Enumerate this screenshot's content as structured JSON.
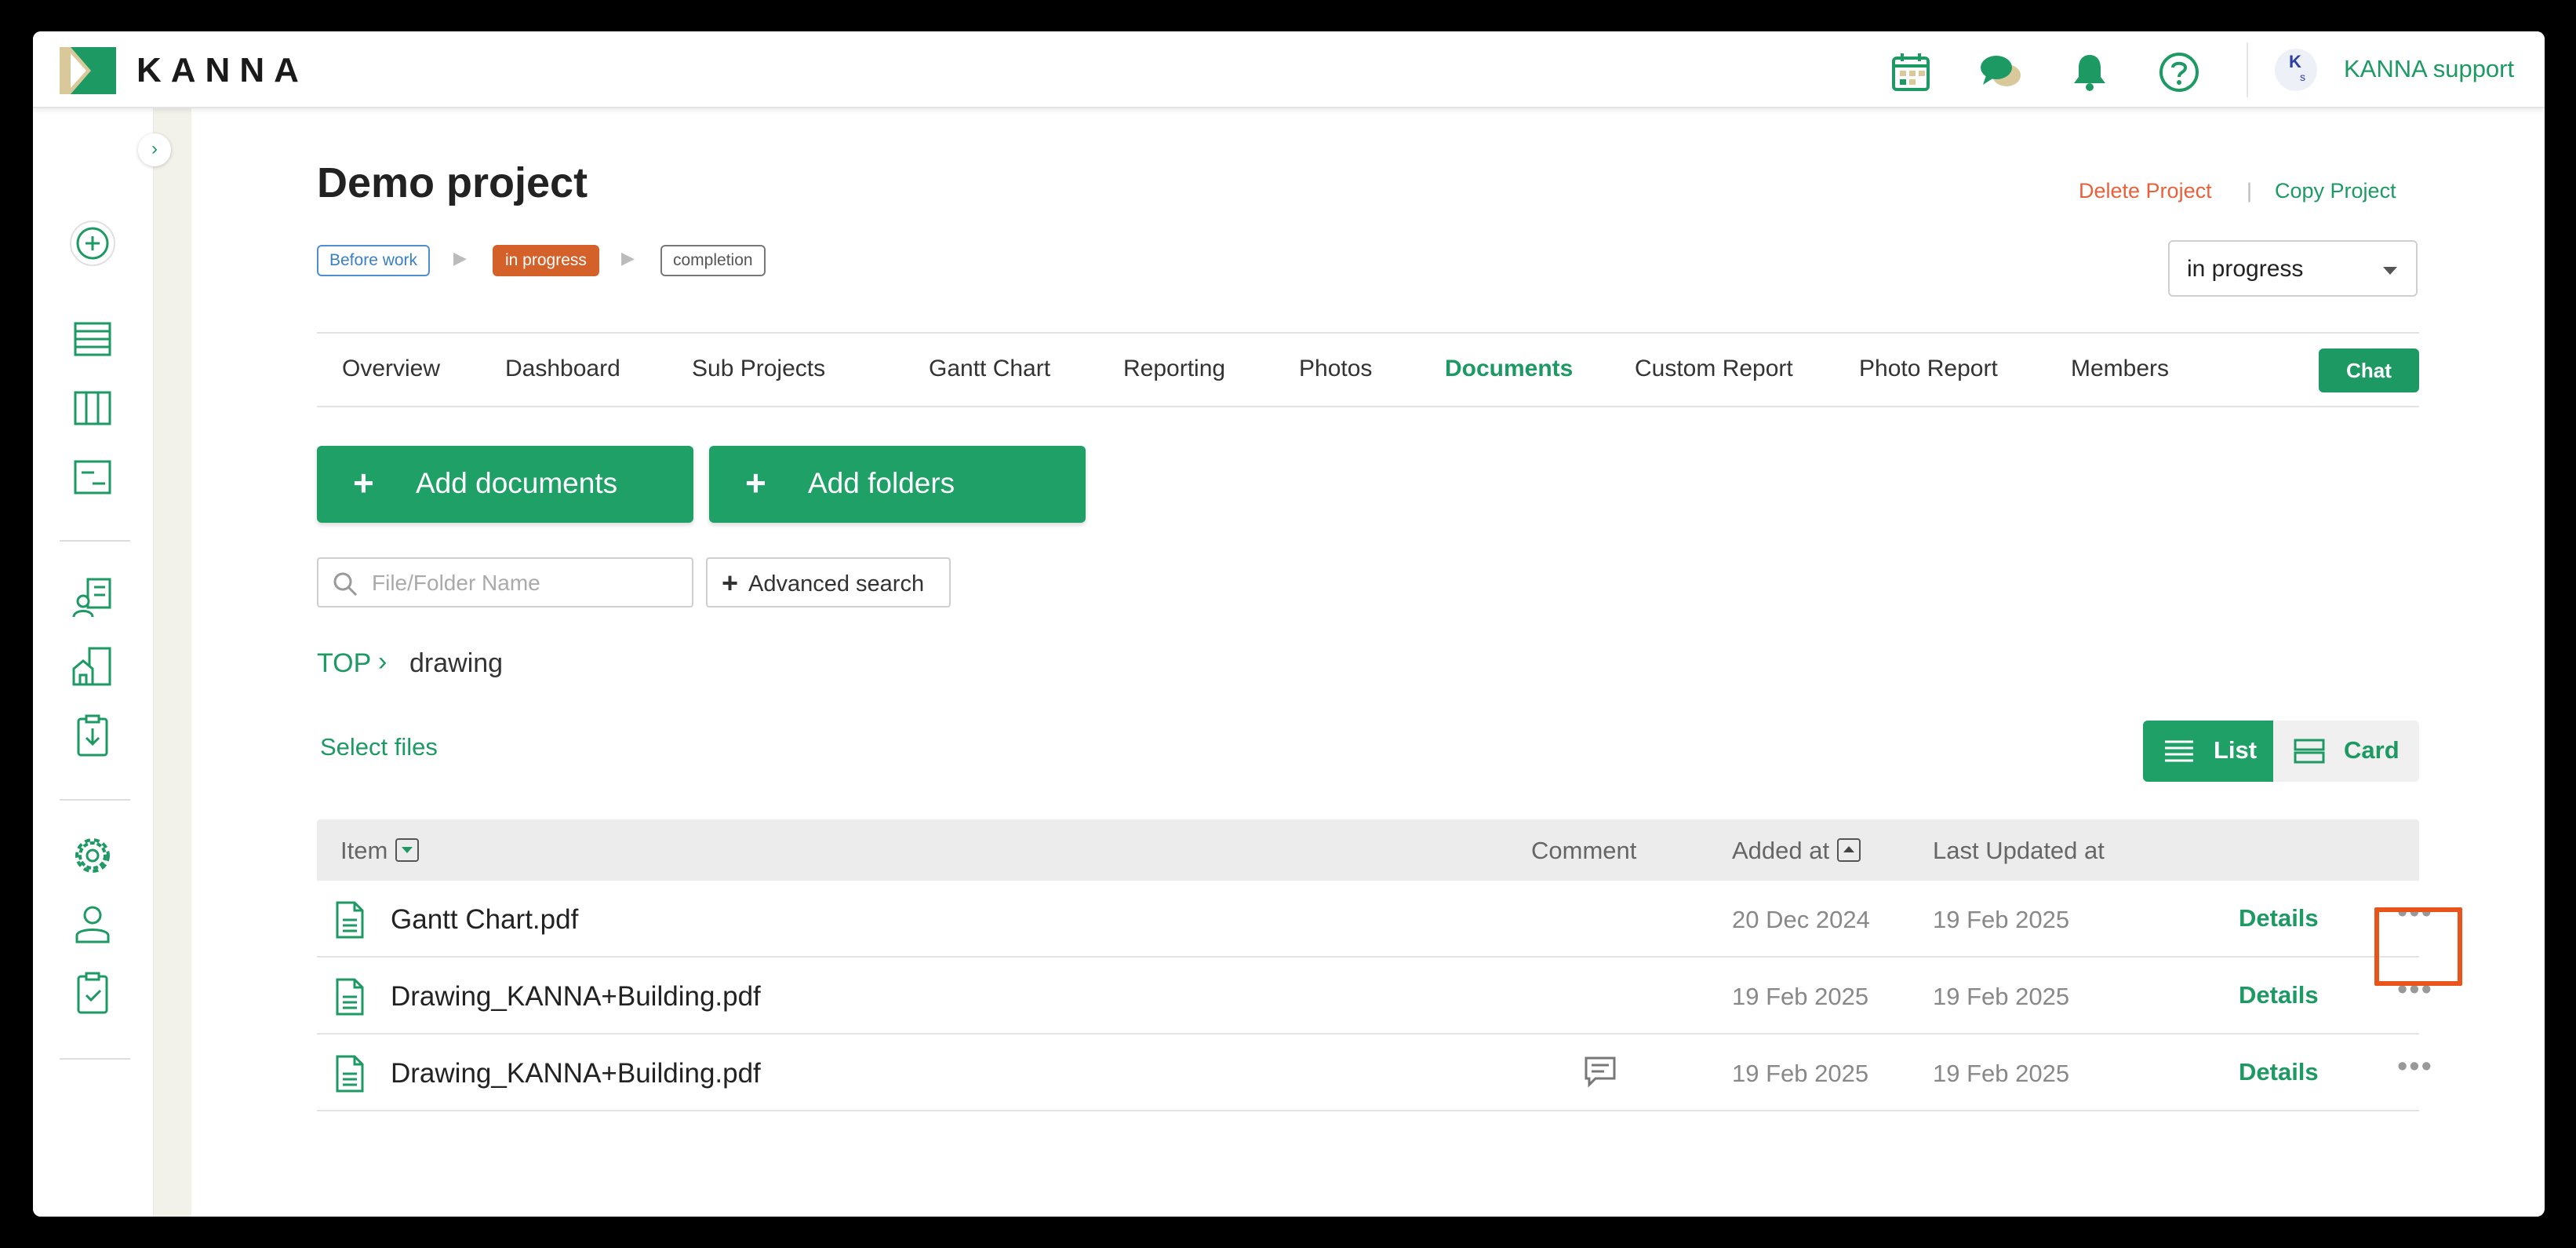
{
  "header": {
    "logo_text": "KANNA",
    "user": {
      "avatar_initial": "K",
      "avatar_sub": "s",
      "name": "KANNA support"
    },
    "icons": [
      "calendar-icon",
      "chat-bubbles-icon",
      "bell-icon",
      "help-icon"
    ]
  },
  "sidebar": {
    "icons": [
      "add-circle-icon",
      "list-icon",
      "columns-icon",
      "report-icon",
      "client-icon",
      "building-icon",
      "clipboard-download-icon",
      "settings-icon",
      "user-icon",
      "clipboard-check-icon"
    ]
  },
  "project": {
    "title": "Demo project",
    "delete_label": "Delete Project",
    "link_separator": "|",
    "copy_label": "Copy Project",
    "stages": [
      "Before work",
      "in progress",
      "completion"
    ],
    "current_stage": "in progress",
    "status_value": "in progress"
  },
  "tabs": [
    "Overview",
    "Dashboard",
    "Sub Projects",
    "Gantt Chart",
    "Reporting",
    "Photos",
    "Documents",
    "Custom Report",
    "Photo Report",
    "Members"
  ],
  "active_tab": "Documents",
  "chat_label": "Chat",
  "actions": {
    "add_documents": "Add documents",
    "add_folders": "Add folders",
    "plus": "+"
  },
  "search": {
    "placeholder": "File/Folder Name",
    "advanced_label": "Advanced search"
  },
  "breadcrumb": {
    "root": "TOP",
    "separator": "›",
    "current": "drawing"
  },
  "select_files_label": "Select files",
  "view": {
    "list_label": "List",
    "card_label": "Card",
    "selected": "List"
  },
  "table": {
    "columns": {
      "item": "Item",
      "comment": "Comment",
      "added": "Added at",
      "updated": "Last Updated at"
    },
    "rows": [
      {
        "name": "Gantt Chart.pdf",
        "has_comment": false,
        "added": "20 Dec 2024",
        "updated": "19 Feb 2025",
        "details": "Details",
        "more": "•••"
      },
      {
        "name": "Drawing_KANNA+Building.pdf",
        "has_comment": false,
        "added": "19 Feb 2025",
        "updated": "19 Feb 2025",
        "details": "Details",
        "more": "•••"
      },
      {
        "name": "Drawing_KANNA+Building.pdf",
        "has_comment": true,
        "added": "19 Feb 2025",
        "updated": "19 Feb 2025",
        "details": "Details",
        "more": "•••"
      }
    ]
  },
  "colors": {
    "brand_green": "#1d9a63",
    "button_green": "#1fa067",
    "delete_red": "#e8603c",
    "stage_progress": "#d4612a",
    "highlight": "#e8541c"
  }
}
